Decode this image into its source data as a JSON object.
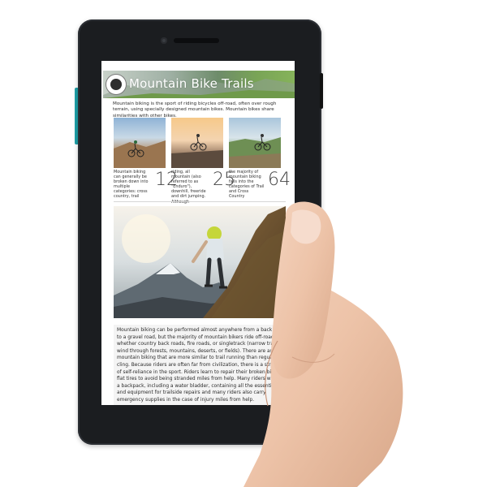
{
  "article": {
    "title": "Mountain Bike Trails",
    "intro": "Mountain biking is the sport of riding bicycles off-road, often over rough terrain, using specially designed mountain bikes. Mountain bikes share similarities with other bikes.",
    "features": [
      {
        "caption": "Mountain biking can generally be broken down into multiple categories: cross country, trail",
        "number": "12"
      },
      {
        "caption": "riding, all mountain (also referred to as \"Enduro\"), downhill, freeride and dirt jumping. Although",
        "number": "25"
      },
      {
        "caption": "the majority of mountain biking falls into the categories of Trail and Cross Country",
        "number": "64"
      }
    ],
    "body_lines": [
      "Mountain biking can be performed almost anywhere from a back yard",
      "to a gravel road, but the majority of mountain bikers ride off-road trails,",
      "whether country back roads, fire roads, or singletrack (narrow trails that",
      "wind through forests, mountains, deserts, or fields). There are aspects of",
      "mountain biking that are more similar to trail running than regular bicy-",
      "cling. Because riders are often far from civilization, there is a strong e",
      "of self-reliance in the sport. Riders learn to repair their broken bikes",
      "flat tires to avoid being stranded miles from help. Many riders w",
      "a backpack, including a water bladder, containing all the essenti",
      "and equipment for trailside repairs and many riders also carry",
      "emergency supplies in the case of injury miles from help."
    ]
  },
  "colors": {
    "tablet": "#1b1d20",
    "accent": "#1ea0a8",
    "banner_green": "#79a456"
  },
  "icons": {
    "logo": "mountain-bike-logo-icon"
  }
}
